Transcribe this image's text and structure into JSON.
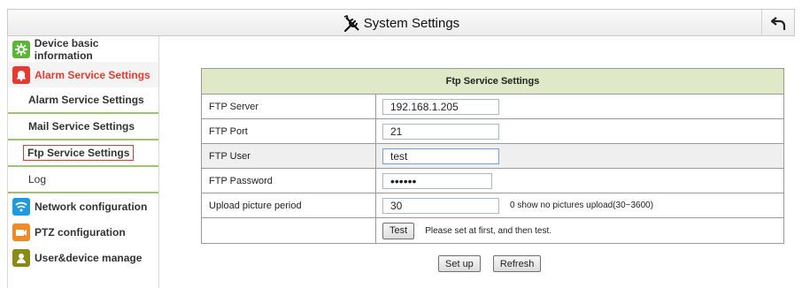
{
  "header": {
    "title": "System Settings"
  },
  "sidebar": {
    "groups": [
      {
        "label": "Device basic information"
      },
      {
        "label": "Alarm Service Settings"
      },
      {
        "label": "Network configuration"
      },
      {
        "label": "PTZ configuration"
      },
      {
        "label": "User&device manage"
      }
    ],
    "subitems": [
      {
        "label": "Alarm Service Settings"
      },
      {
        "label": "Mail Service Settings"
      },
      {
        "label": "Ftp Service Settings"
      },
      {
        "label": "Log"
      }
    ]
  },
  "panel": {
    "title": "Ftp Service Settings",
    "rows": [
      {
        "label": "FTP Server",
        "value": "192.168.1.205"
      },
      {
        "label": "FTP Port",
        "value": "21"
      },
      {
        "label": "FTP User",
        "value": "test"
      },
      {
        "label": "FTP Password",
        "value": "••••••"
      },
      {
        "label": "Upload picture period",
        "value": "30",
        "note": "0 show no pictures upload(30~3600)"
      }
    ],
    "test_button": "Test",
    "test_hint": "Please set at first, and then test."
  },
  "actions": {
    "setup": "Set up",
    "refresh": "Refresh"
  },
  "colors": {
    "accent_green": "#9fc36a",
    "alarm_red": "#e8392f",
    "network_blue": "#1e9be0",
    "ptz_orange": "#f08a24",
    "user_olive": "#8a8a14"
  }
}
